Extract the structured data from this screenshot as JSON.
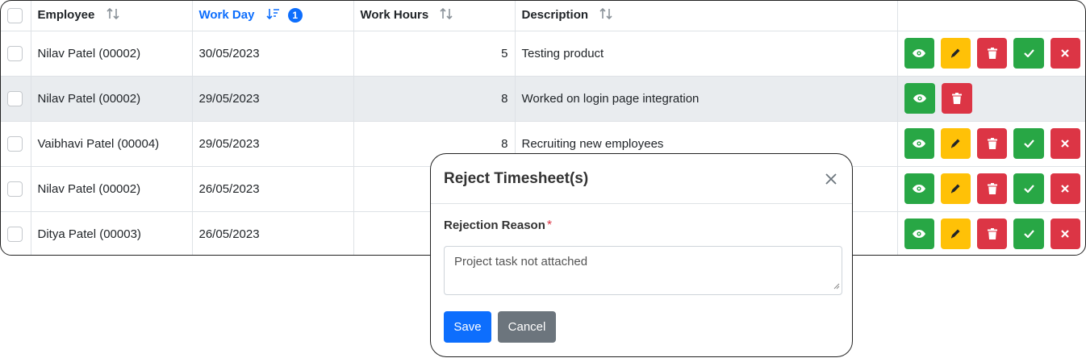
{
  "table": {
    "columns": [
      {
        "label": "Employee"
      },
      {
        "label": "Work Day",
        "sort_badge": "1"
      },
      {
        "label": "Work Hours"
      },
      {
        "label": "Description"
      }
    ],
    "rows": [
      {
        "employee": "Nilav Patel (00002)",
        "work_day": "30/05/2023",
        "work_hours": "5",
        "description": "Testing product"
      },
      {
        "employee": "Nilav Patel (00002)",
        "work_day": "29/05/2023",
        "work_hours": "8",
        "description": "Worked on login page integration"
      },
      {
        "employee": "Vaibhavi Patel (00004)",
        "work_day": "29/05/2023",
        "work_hours": "8",
        "description": "Recruiting new employees"
      },
      {
        "employee": "Nilav Patel (00002)",
        "work_day": "26/05/2023",
        "work_hours": "",
        "description": ""
      },
      {
        "employee": "Ditya Patel (00003)",
        "work_day": "26/05/2023",
        "work_hours": "",
        "description": ""
      }
    ],
    "action_icons": [
      "eye-icon",
      "pencil-icon",
      "trash-icon",
      "check-icon",
      "x-icon"
    ]
  },
  "modal": {
    "title": "Reject Timesheet(s)",
    "field_label": "Rejection Reason",
    "required_mark": "*",
    "reason_value": "Project task not attached",
    "save_label": "Save",
    "cancel_label": "Cancel"
  },
  "colors": {
    "primary": "#0d6efd",
    "success": "#28a745",
    "warning": "#ffc107",
    "danger": "#dc3545",
    "secondary": "#6c757d"
  }
}
